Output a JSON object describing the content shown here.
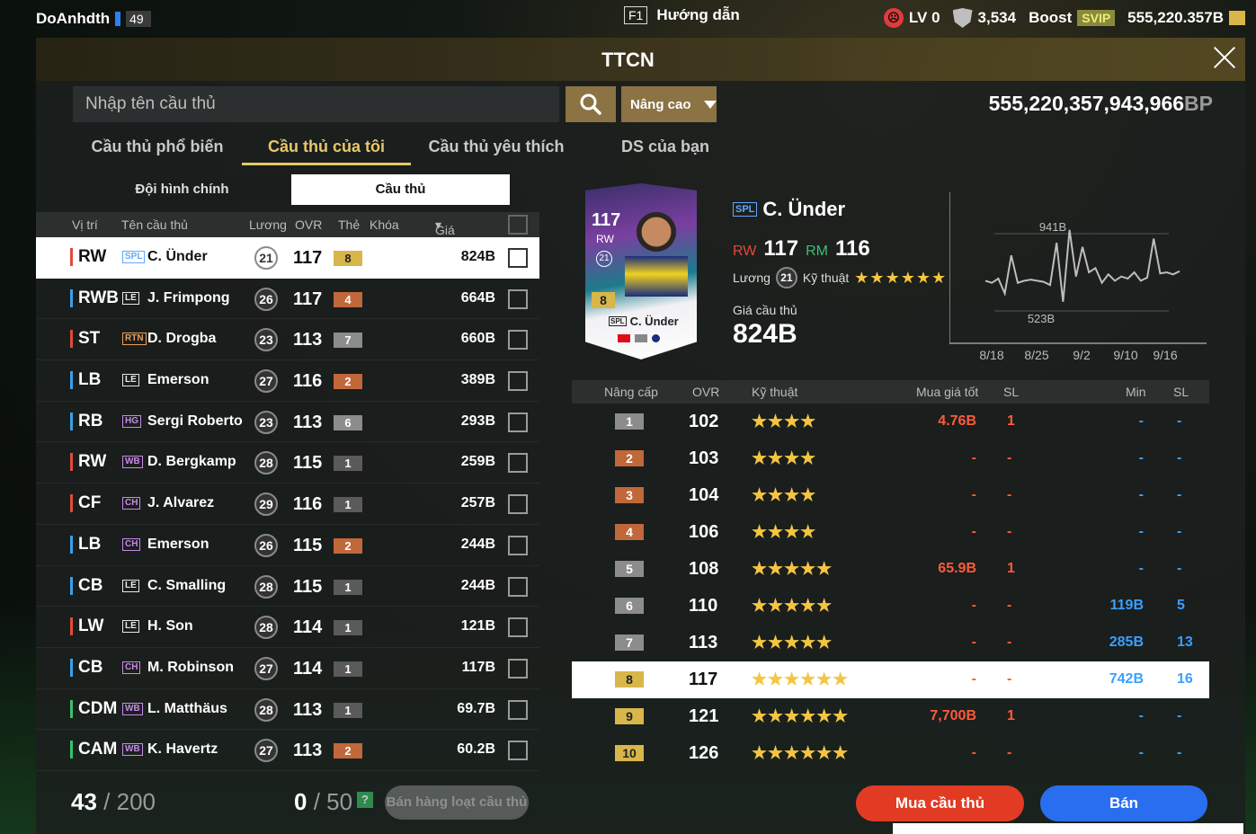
{
  "topbar": {
    "username": "DoAnhdth",
    "level": "49",
    "guide_key": "F1",
    "guide_label": "Hướng dẫn",
    "lv_label": "LV 0",
    "shield_value": "3,534",
    "boost_label": "Boost",
    "svip_label": "SVIP",
    "bp_short": "555,220.357B"
  },
  "title": "TTCN",
  "search": {
    "placeholder": "Nhập tên cầu thủ",
    "advanced_label": "Nâng cao"
  },
  "bp": {
    "value": "555,220,357,943,966",
    "unit": "BP"
  },
  "tabs": [
    "Cầu thủ phổ biến",
    "Cầu thủ của tôi",
    "Cầu thủ yêu thích",
    "DS của bạn"
  ],
  "subtabs": [
    "Đội hình chính",
    "Cầu thủ"
  ],
  "list_headers": {
    "position": "Vị trí",
    "name": "Tên cầu thủ",
    "wage": "Lương",
    "ovr": "OVR",
    "grade": "Thẻ",
    "lock": "Khóa",
    "price": "Giá cầu thủ"
  },
  "players": [
    {
      "pos": "RW",
      "season": "SPL",
      "name": "C. Ünder",
      "wage": "21",
      "ovr": "117",
      "grade": "8",
      "price": "824B",
      "line": "fwd",
      "gclass": "g-gold",
      "sc": "#5fa8ff"
    },
    {
      "pos": "RWB",
      "season": "LE",
      "name": "J. Frimpong",
      "wage": "26",
      "ovr": "117",
      "grade": "4",
      "price": "664B",
      "line": "def",
      "gclass": "g-bronze",
      "sc": "#e8e8e8"
    },
    {
      "pos": "ST",
      "season": "RTN",
      "name": "D. Drogba",
      "wage": "23",
      "ovr": "113",
      "grade": "7",
      "price": "660B",
      "line": "fwd",
      "gclass": "g-silver",
      "sc": "#e8a060"
    },
    {
      "pos": "LB",
      "season": "LE",
      "name": "Emerson",
      "wage": "27",
      "ovr": "116",
      "grade": "2",
      "price": "389B",
      "line": "def",
      "gclass": "g-bronze",
      "sc": "#e8e8e8"
    },
    {
      "pos": "RB",
      "season": "HG",
      "name": "Sergi Roberto",
      "wage": "23",
      "ovr": "113",
      "grade": "6",
      "price": "293B",
      "line": "def",
      "gclass": "g-silver",
      "sc": "#c88ae8"
    },
    {
      "pos": "RW",
      "season": "WB",
      "name": "D. Bergkamp",
      "wage": "28",
      "ovr": "115",
      "grade": "1",
      "price": "259B",
      "line": "fwd",
      "gclass": "g-dark",
      "sc": "#c88ae8"
    },
    {
      "pos": "CF",
      "season": "CH",
      "name": "J. Alvarez",
      "wage": "29",
      "ovr": "116",
      "grade": "1",
      "price": "257B",
      "line": "fwd",
      "gclass": "g-dark",
      "sc": "#c88ae8"
    },
    {
      "pos": "LB",
      "season": "CH",
      "name": "Emerson",
      "wage": "26",
      "ovr": "115",
      "grade": "2",
      "price": "244B",
      "line": "def",
      "gclass": "g-bronze",
      "sc": "#c88ae8"
    },
    {
      "pos": "CB",
      "season": "LE",
      "name": "C. Smalling",
      "wage": "28",
      "ovr": "115",
      "grade": "1",
      "price": "244B",
      "line": "def",
      "gclass": "g-dark",
      "sc": "#e8e8e8"
    },
    {
      "pos": "LW",
      "season": "LE",
      "name": "H. Son",
      "wage": "28",
      "ovr": "114",
      "grade": "1",
      "price": "121B",
      "line": "fwd",
      "gclass": "g-dark",
      "sc": "#e8e8e8"
    },
    {
      "pos": "CB",
      "season": "CH",
      "name": "M. Robinson",
      "wage": "27",
      "ovr": "114",
      "grade": "1",
      "price": "117B",
      "line": "def",
      "gclass": "g-dark",
      "sc": "#c88ae8"
    },
    {
      "pos": "CDM",
      "season": "WB",
      "name": "L. Matthäus",
      "wage": "28",
      "ovr": "113",
      "grade": "1",
      "price": "69.7B",
      "line": "mid",
      "gclass": "g-dark",
      "sc": "#c88ae8"
    },
    {
      "pos": "CAM",
      "season": "WB",
      "name": "K. Havertz",
      "wage": "27",
      "ovr": "113",
      "grade": "2",
      "price": "60.2B",
      "line": "mid",
      "gclass": "g-bronze",
      "sc": "#c88ae8"
    }
  ],
  "footer": {
    "count": "43",
    "capacity": "/ 200",
    "selected": "0",
    "sel_capacity": "/ 50",
    "help": "?",
    "bulk_sell": "Bán hàng loạt cầu thủ"
  },
  "detail": {
    "season": "SPL",
    "name": "C. Ünder",
    "pos1": "RW",
    "ovr1": "117",
    "pos2": "RM",
    "ovr2": "116",
    "wage_label": "Lương",
    "wage": "21",
    "skill_label": "Kỹ thuật",
    "skill_stars": "★★★★★★",
    "price_label": "Giá cầu thủ",
    "price": "824B",
    "card": {
      "ovr": "117",
      "pos": "RW",
      "wage": "21",
      "grade": "8",
      "name": "C. Ünder",
      "season": "SPL"
    }
  },
  "chart_data": {
    "type": "line",
    "x": [
      "8/18",
      "8/25",
      "9/2",
      "9/10",
      "9/16"
    ],
    "values": [
      700,
      690,
      710,
      640,
      820,
      690,
      700,
      705,
      700,
      695,
      680,
      880,
      600,
      941,
      720,
      860,
      740,
      760,
      690,
      730,
      700,
      720,
      710,
      740,
      700,
      715,
      900,
      735,
      740,
      730,
      745
    ],
    "max_label": "941B",
    "min_label": "523B",
    "ylim": [
      480,
      1000
    ]
  },
  "level_headers": {
    "level": "Nâng cấp",
    "ovr": "OVR",
    "skill": "Kỹ thuật",
    "best_buy": "Mua giá tốt",
    "sl1": "SL",
    "min": "Min",
    "sl2": "SL"
  },
  "levels": [
    {
      "lv": "1",
      "ovr": "102",
      "stars": "★★★★",
      "buy": "4.76B",
      "sl1": "1",
      "min": "-",
      "sl2": "-",
      "lc": "#8c8c8c"
    },
    {
      "lv": "2",
      "ovr": "103",
      "stars": "★★★★",
      "buy": "-",
      "sl1": "-",
      "min": "-",
      "sl2": "-",
      "lc": "#c0683a"
    },
    {
      "lv": "3",
      "ovr": "104",
      "stars": "★★★★",
      "buy": "-",
      "sl1": "-",
      "min": "-",
      "sl2": "-",
      "lc": "#c0683a"
    },
    {
      "lv": "4",
      "ovr": "106",
      "stars": "★★★★",
      "buy": "-",
      "sl1": "-",
      "min": "-",
      "sl2": "-",
      "lc": "#c0683a"
    },
    {
      "lv": "5",
      "ovr": "108",
      "stars": "★★★★★",
      "buy": "65.9B",
      "sl1": "1",
      "min": "-",
      "sl2": "-",
      "lc": "#8c8c8c"
    },
    {
      "lv": "6",
      "ovr": "110",
      "stars": "★★★★★",
      "buy": "-",
      "sl1": "-",
      "min": "119B",
      "sl2": "5",
      "lc": "#8c8c8c"
    },
    {
      "lv": "7",
      "ovr": "113",
      "stars": "★★★★★",
      "buy": "-",
      "sl1": "-",
      "min": "285B",
      "sl2": "13",
      "lc": "#8c8c8c"
    },
    {
      "lv": "8",
      "ovr": "117",
      "stars": "★★★★★★",
      "buy": "-",
      "sl1": "-",
      "min": "742B",
      "sl2": "16",
      "lc": "#d9b64a"
    },
    {
      "lv": "9",
      "ovr": "121",
      "stars": "★★★★★★",
      "buy": "7,700B",
      "sl1": "1",
      "min": "-",
      "sl2": "-",
      "lc": "#d9b64a"
    },
    {
      "lv": "10",
      "ovr": "126",
      "stars": "★★★★★★",
      "buy": "-",
      "sl1": "-",
      "min": "-",
      "sl2": "-",
      "lc": "#d9b64a"
    }
  ],
  "actions": {
    "buy": "Mua cầu thủ",
    "sell": "Bán"
  }
}
